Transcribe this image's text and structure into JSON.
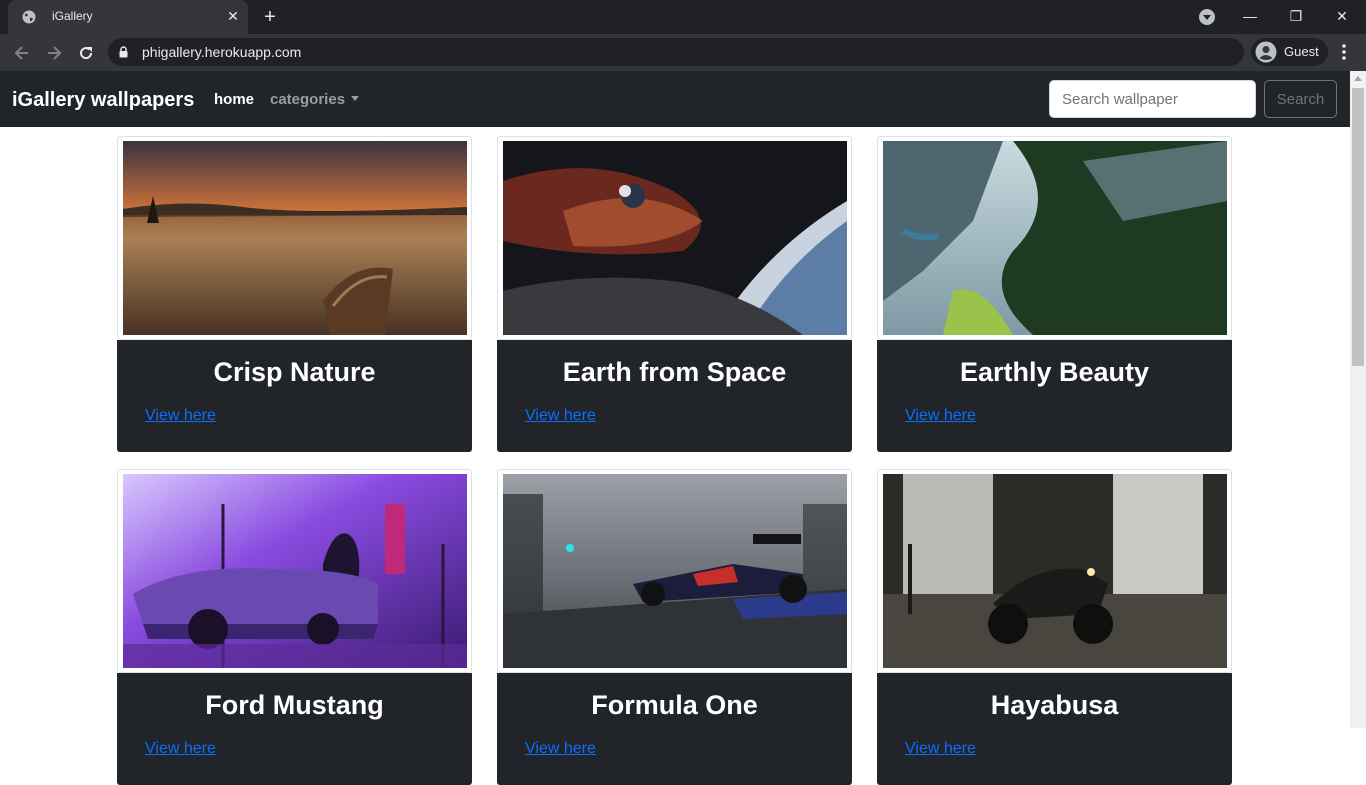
{
  "browser": {
    "tab_title": "iGallery",
    "tab_close": "✕",
    "new_tab": "+",
    "url": "phigallery.herokuapp.com",
    "profile_name": "Guest",
    "win_minimize": "—",
    "win_restore": "❐",
    "win_close": "✕"
  },
  "navbar": {
    "brand": "iGallery wallpapers",
    "home": "home",
    "categories": "categories",
    "search_placeholder": "Search wallpaper",
    "search_button": "Search"
  },
  "cards": [
    {
      "title": "Crisp Nature",
      "link": "View here"
    },
    {
      "title": "Earth from Space",
      "link": "View here"
    },
    {
      "title": "Earthly Beauty",
      "link": "View here"
    },
    {
      "title": "Ford Mustang",
      "link": "View here"
    },
    {
      "title": "Formula One",
      "link": "View here"
    },
    {
      "title": "Hayabusa",
      "link": "View here"
    }
  ],
  "colors": {
    "navbar_bg": "#212529",
    "card_body_bg": "#212529",
    "link": "#0d6efd",
    "chrome_dark": "#202124"
  }
}
